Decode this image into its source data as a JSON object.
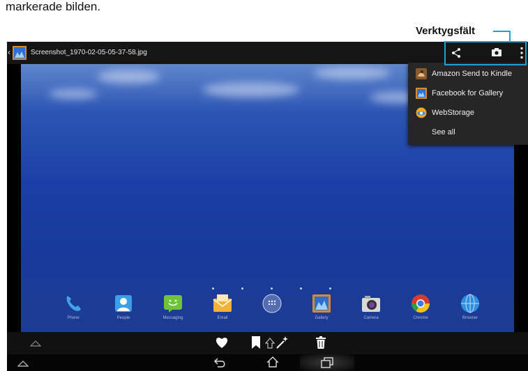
{
  "caption": "markerade bilden.",
  "annotation": {
    "label": "Verktygsfält"
  },
  "topbar": {
    "title": "Screenshot_1970-02-05-05-37-58.jpg",
    "back_glyph": "‹"
  },
  "share_menu": {
    "items": [
      {
        "label": "Amazon Send to Kindle",
        "icon": "kindle-icon"
      },
      {
        "label": "Facebook for Gallery",
        "icon": "gallery-icon"
      },
      {
        "label": "WebStorage",
        "icon": "webstorage-icon"
      },
      {
        "label": "See all",
        "icon": ""
      }
    ]
  },
  "dock": {
    "apps": [
      {
        "label": "Phone",
        "icon": "phone-icon"
      },
      {
        "label": "People",
        "icon": "people-icon"
      },
      {
        "label": "Messaging",
        "icon": "messaging-icon"
      },
      {
        "label": "Email",
        "icon": "email-icon"
      },
      {
        "label": "",
        "icon": "all-apps-icon"
      },
      {
        "label": "Gallery",
        "icon": "gallery-icon"
      },
      {
        "label": "Camera",
        "icon": "camera-icon"
      },
      {
        "label": "Chrome",
        "icon": "chrome-icon"
      },
      {
        "label": "Browser",
        "icon": "browser-icon"
      }
    ]
  },
  "action_bar": {
    "icons": [
      "favorite-icon",
      "bookmark-icon",
      "rotate-icon",
      "magic-wand-icon",
      "delete-icon"
    ]
  },
  "nav_bar": {
    "icons": [
      "collapse-icon",
      "back-icon",
      "home-icon",
      "recent-apps-icon"
    ]
  },
  "colors": {
    "highlight": "#17a3d8",
    "menu_bg": "#262626",
    "topbar_bg": "#151515",
    "wallpaper": "#1b3ea6"
  }
}
